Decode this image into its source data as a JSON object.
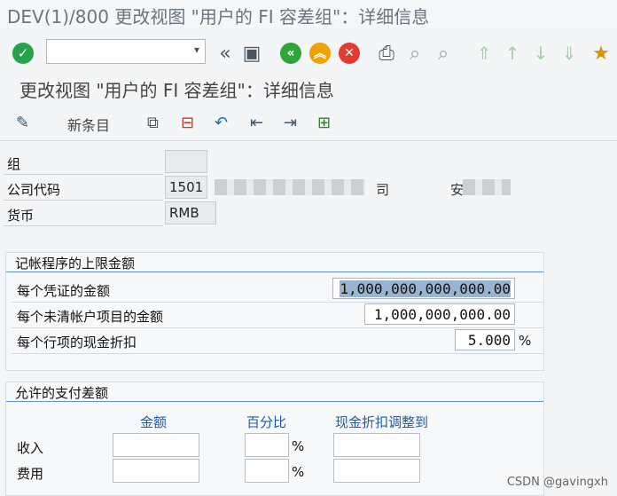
{
  "window": {
    "title": "DEV(1)/800 更改视图 \"用户的 FI 容差组\"：详细信息"
  },
  "toolbar": {
    "command_field_value": "",
    "icons": [
      "check-icon",
      "dropdown-icon",
      "back-double-icon",
      "save-icon",
      "back-icon",
      "exit-icon",
      "cancel-icon",
      "print-icon",
      "find-icon",
      "find-next-icon",
      "first-page-icon",
      "previous-page-icon",
      "next-page-icon",
      "last-page-icon",
      "layout-icon"
    ]
  },
  "screen": {
    "title": "更改视图 \"用户的 FI 容差组\"：详细信息"
  },
  "app_toolbar": {
    "new_entries_label": "新条目"
  },
  "header_fields": {
    "group_label": "组",
    "group_value": "",
    "company_code_label": "公司代码",
    "company_code_value": "1501",
    "company_name_suffix": "司",
    "city_prefix": "安",
    "currency_label": "货币",
    "currency_value": "RMB"
  },
  "posting_limits": {
    "title": "记帐程序的上限金额",
    "rows": [
      {
        "label": "每个凭证的金额",
        "value": "1,000,000,000,000.00"
      },
      {
        "label": "每个未清帐户项目的金额",
        "value": "1,000,000,000.00"
      },
      {
        "label": "每个行项的现金折扣",
        "value": "5.000",
        "unit": "%"
      }
    ]
  },
  "payment_diffs": {
    "title": "允许的支付差额",
    "col_amount": "金额",
    "col_percent": "百分比",
    "col_discount": "现金折扣调整到",
    "percent_sign": "%",
    "rows": [
      {
        "label": "收入",
        "amount": "",
        "percent": "",
        "discount": ""
      },
      {
        "label": "费用",
        "amount": "",
        "percent": "",
        "discount": ""
      }
    ]
  },
  "watermark": "CSDN @gavingxh"
}
